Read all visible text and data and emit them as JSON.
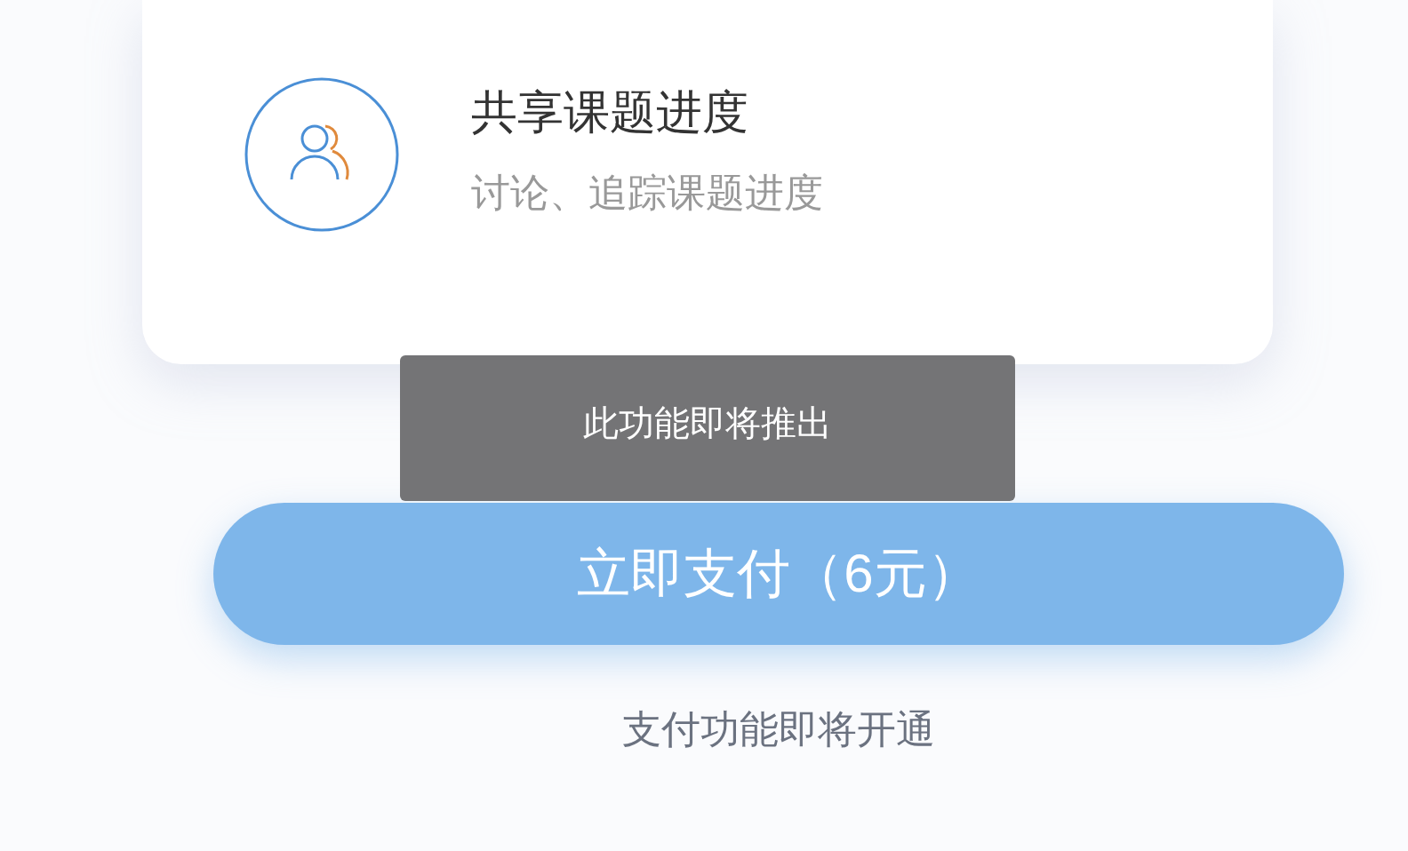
{
  "feature_card": {
    "title": "共享课题进度",
    "subtitle": "讨论、追踪课题进度"
  },
  "toast": "此功能即将推出",
  "pay_button": "立即支付（6元）",
  "note": "支付功能即将开通"
}
